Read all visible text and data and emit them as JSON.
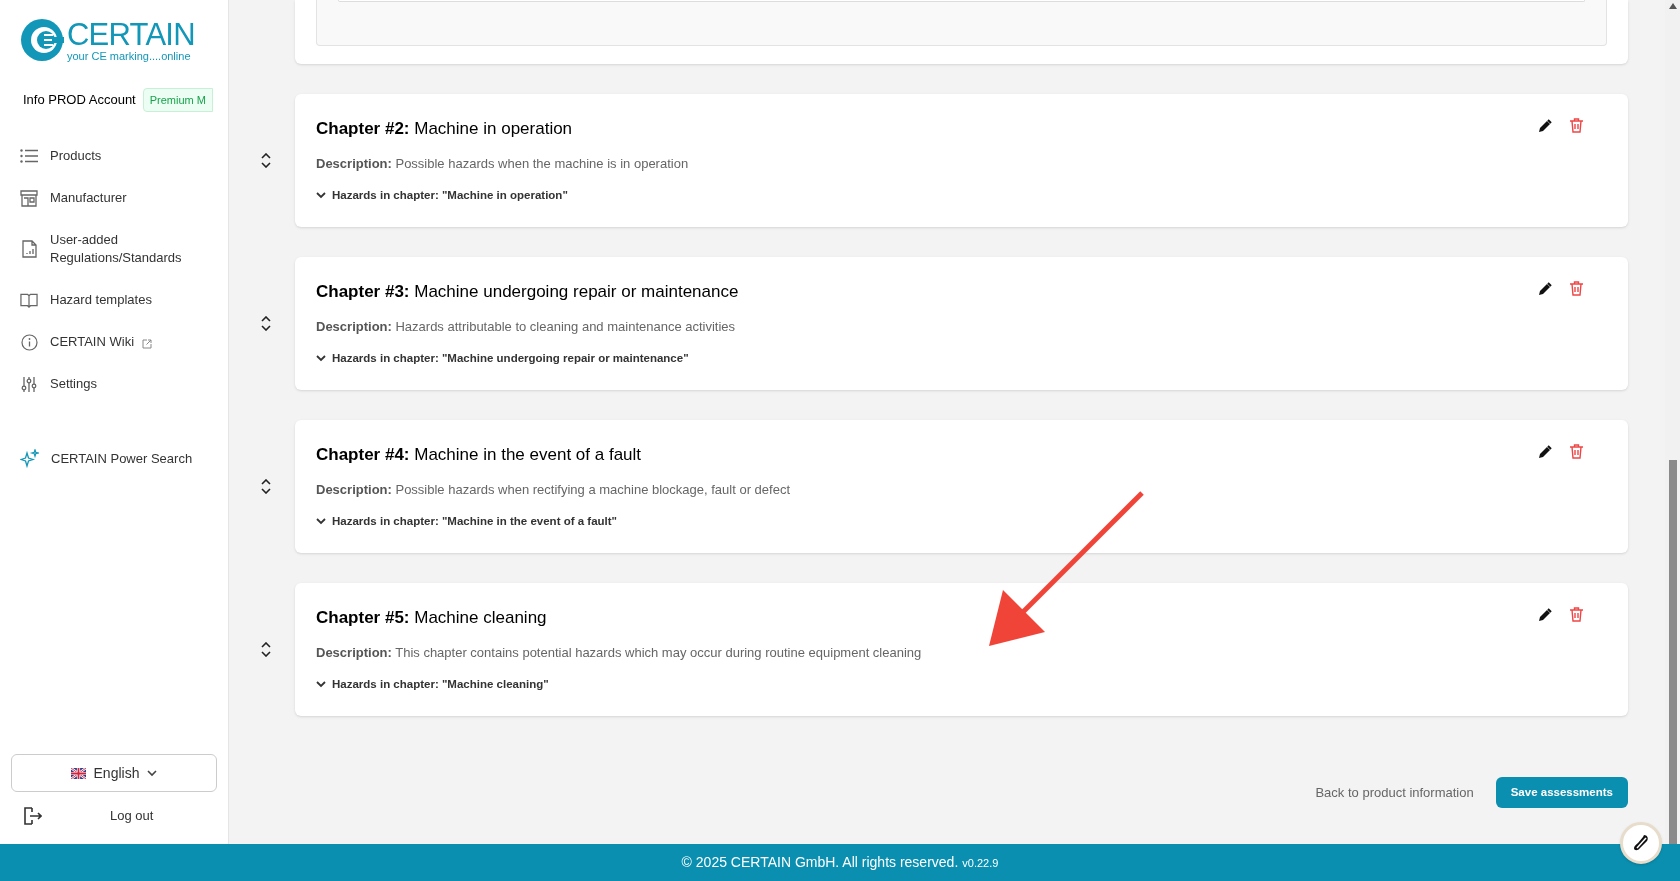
{
  "sidebar": {
    "logo": {
      "name": "CERTAIN",
      "tagline": "your CE marking....online"
    },
    "account": {
      "name": "Info PROD Account",
      "badge": "Premium M"
    },
    "items": [
      {
        "label": "Products",
        "external": false
      },
      {
        "label": "Manufacturer",
        "external": false
      },
      {
        "label": "User-added Regulations/Standards",
        "external": false
      },
      {
        "label": "Hazard templates",
        "external": false
      },
      {
        "label": "CERTAIN Wiki",
        "external": true
      },
      {
        "label": "Settings",
        "external": false
      }
    ],
    "power_search": {
      "label": "CERTAIN Power Search"
    },
    "language": {
      "value": "English"
    },
    "logout": {
      "label": "Log out"
    }
  },
  "chapters": [
    {
      "title": "**Chapter #2:** Machine in operation",
      "description": "**Description:** Possible hazards when the machine is in operation",
      "hazards": "Hazards in chapter: \"Machine in operation\"",
      "expanded": false
    },
    {
      "title": "**Chapter #3:** Machine undergoing repair or maintenance",
      "description": "**Description:** Hazards attributable to cleaning and maintenance activities",
      "hazards": "Hazards in chapter: \"Machine undergoing repair or maintenance\"",
      "expanded": false
    },
    {
      "title": "**Chapter #4:** Machine in the event of a fault",
      "description": "**Description:** Possible hazards when rectifying a machine blockage, fault or defect",
      "hazards": "Hazards in chapter: \"Machine in the event of a fault\"",
      "expanded": false
    },
    {
      "title": "**Chapter #5:** Machine cleaning",
      "description": "**Description:** This chapter contains potential hazards which may occur during routine equipment cleaning",
      "hazards": "Hazards in chapter: \"Machine cleaning\"",
      "expanded": false
    }
  ],
  "actions": {
    "back": "Back to product information",
    "save": "Save assessments"
  },
  "footer": {
    "copyright": "© 2025 CERTAIN GmbH. All rights reserved.",
    "version": "v0.22.9"
  }
}
